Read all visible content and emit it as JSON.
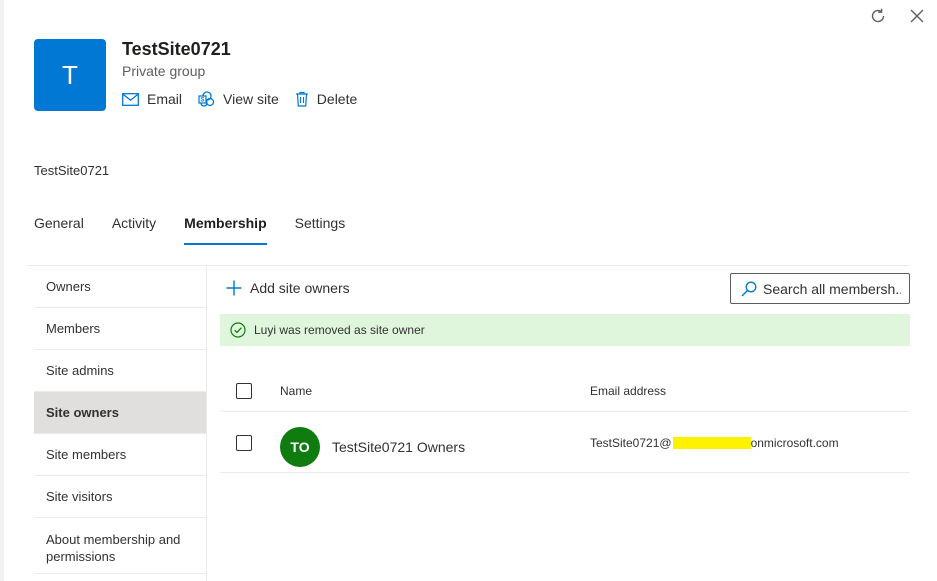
{
  "window": {
    "refresh_icon": "refresh-icon",
    "close_icon": "close-icon"
  },
  "header": {
    "avatar_letter": "T",
    "avatar_color": "#0078d4",
    "title": "TestSite0721",
    "subtitle": "Private group",
    "actions": [
      {
        "label": "Email",
        "icon": "mail-icon"
      },
      {
        "label": "View site",
        "icon": "sharepoint-icon"
      },
      {
        "label": "Delete",
        "icon": "trash-icon"
      }
    ]
  },
  "breadcrumb": "TestSite0721",
  "tabs": [
    {
      "label": "General",
      "active": false
    },
    {
      "label": "Activity",
      "active": false
    },
    {
      "label": "Membership",
      "active": true
    },
    {
      "label": "Settings",
      "active": false
    }
  ],
  "accent_color": "#0078d4",
  "sidebar": {
    "items": [
      {
        "label": "Owners",
        "active": false
      },
      {
        "label": "Members",
        "active": false
      },
      {
        "label": "Site admins",
        "active": false
      },
      {
        "label": "Site owners",
        "active": true
      },
      {
        "label": "Site members",
        "active": false
      },
      {
        "label": "Site visitors",
        "active": false
      },
      {
        "label": "About membership and permissions",
        "active": false
      }
    ]
  },
  "toolbar": {
    "add_label": "Add site owners",
    "search_placeholder": "Search all membersh..."
  },
  "notification": {
    "text": "Luyi was removed as site owner",
    "color": "#dff6dd",
    "icon": "check-circle-icon"
  },
  "table": {
    "columns": {
      "name": "Name",
      "email": "Email address"
    },
    "rows": [
      {
        "initials": "TO",
        "avatar_color": "#107c10",
        "name": "TestSite0721 Owners",
        "email_prefix": "TestSite0721@",
        "email_suffix": "onmicrosoft.com"
      }
    ]
  }
}
